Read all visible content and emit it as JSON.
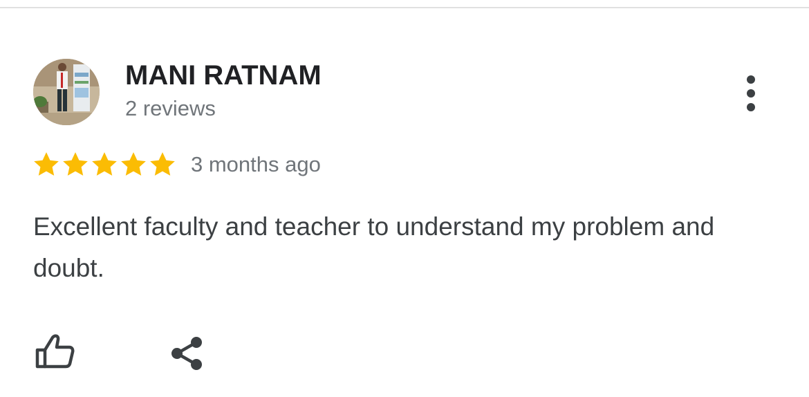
{
  "review": {
    "author_name": "MANI RATNAM",
    "author_review_count": "2 reviews",
    "rating": 5,
    "rating_max": 5,
    "time_ago": "3 months ago",
    "text": "Excellent faculty and teacher to understand my problem and doubt."
  },
  "icons": {
    "more": "more-vert-icon",
    "star": "star-icon",
    "like": "thumb-up-icon",
    "share": "share-icon"
  },
  "colors": {
    "star": "#fbbc04",
    "name": "#202124",
    "secondary_text": "#70757a",
    "body_text": "#3c4043",
    "icon": "#3c4043"
  }
}
